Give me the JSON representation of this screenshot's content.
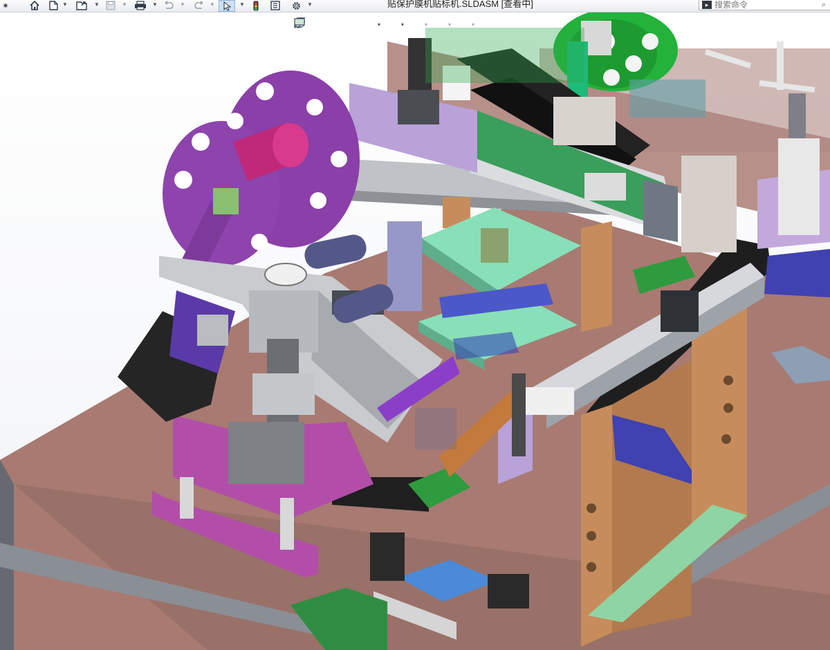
{
  "window": {
    "title": "贴保护膜机贴标机.SLDASM [查看中]"
  },
  "toolbar": {
    "items": [
      {
        "name": "pin-icon"
      },
      {
        "name": "home-icon"
      },
      {
        "name": "new-document-icon"
      },
      {
        "name": "open-icon"
      },
      {
        "name": "save-icon"
      },
      {
        "name": "print-icon"
      },
      {
        "name": "undo-icon"
      },
      {
        "name": "redo-icon"
      },
      {
        "name": "select-pointer-icon"
      },
      {
        "name": "traffic-light-icon"
      },
      {
        "name": "file-properties-icon"
      },
      {
        "name": "options-gear-icon"
      }
    ]
  },
  "search": {
    "placeholder": "搜索命令",
    "icon": "command-search-icon"
  },
  "heads_up_toolbar": {
    "items": [
      {
        "name": "zoom-to-fit-icon"
      },
      {
        "name": "zoom-to-area-icon"
      },
      {
        "name": "previous-view-icon"
      },
      {
        "name": "section-view-icon"
      },
      {
        "name": "view-orientation-icon"
      },
      {
        "name": "display-style-icon"
      },
      {
        "name": "hide-show-items-icon"
      },
      {
        "name": "appearance-icon"
      },
      {
        "name": "scene-icon"
      },
      {
        "name": "view-settings-icon"
      }
    ]
  },
  "colors": {
    "table_top": "#a87a72",
    "frame_gray": "#7d8287",
    "purple": "#8b3fa8",
    "green": "#20b040",
    "wood": "#c78c5c",
    "mint": "#88e0b8",
    "lavender": "#b8a2d8",
    "black": "#1e1e1e",
    "blue": "#4a8ad8"
  }
}
